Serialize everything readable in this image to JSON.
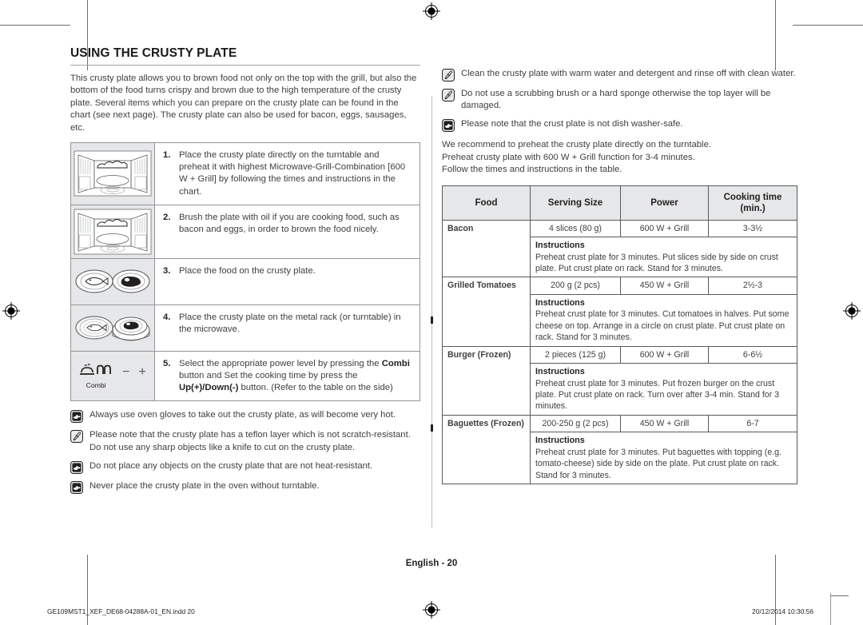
{
  "document": {
    "title": "USING THE CRUSTY PLATE",
    "intro": "This crusty plate allows you to brown food not only on the top with the grill, but also the bottom of the food turns crispy and brown due to the high temperature of the crusty plate. Several items which you can prepare on the crusty plate can be found in the chart (see next page). The crusty plate can also be used for bacon, eggs, sausages, etc.",
    "page_label": "English - 20",
    "footer_left": "GE109MST1_XEF_DE68-04288A-01_EN.indd   20",
    "footer_right": "20/12/2014   10:30:56"
  },
  "steps": [
    {
      "number": "1.",
      "figure": "microwave-open-door-illustration",
      "parts": [
        {
          "text": "Place the crusty plate directly on the turntable and preheat it with highest Microwave-Grill-Combination [600 W + Grill] by following the times and instructions in the chart.",
          "bold": false
        }
      ]
    },
    {
      "number": "2.",
      "figure": "microwave-open-door-illustration",
      "parts": [
        {
          "text": "Brush the plate with oil if you are cooking food, such as bacon and eggs, in order to brown the food nicely.",
          "bold": false
        }
      ]
    },
    {
      "number": "3.",
      "figure": "plates-fish-meat-illustration",
      "parts": [
        {
          "text": "Place the food on the crusty plate.",
          "bold": false
        }
      ]
    },
    {
      "number": "4.",
      "figure": "plates-on-rack-illustration",
      "parts": [
        {
          "text": "Place the crusty plate on the metal rack (or turntable) in the microwave.",
          "bold": false
        }
      ]
    },
    {
      "number": "5.",
      "figure": "combi-button-illustration",
      "parts": [
        {
          "text": "Select the appropriate power level by pressing the ",
          "bold": false
        },
        {
          "text": "Combi",
          "bold": true
        },
        {
          "text": " button and Set the cooking time by press the ",
          "bold": false
        },
        {
          "text": "Up(+)/",
          "bold": true
        },
        {
          "text": "Down(-)",
          "bold": true
        },
        {
          "text": " button. (Refer to the table on the side)",
          "bold": false
        }
      ]
    }
  ],
  "combi_button": {
    "label": "Combi",
    "minus": "−",
    "plus": "+"
  },
  "left_notes": [
    {
      "icon": "hand-pointer-icon",
      "icon_style": "dark",
      "text": "Always use oven gloves to take out the crusty plate, as will become very hot."
    },
    {
      "icon": "note-pencil-icon",
      "icon_style": "light",
      "text": "Please note that the crusty plate has a teflon layer which is not scratch-resistant. Do not use any sharp objects like a knife to cut on the crusty plate."
    },
    {
      "icon": "hand-pointer-icon",
      "icon_style": "dark",
      "text": "Do not place any objects on the crusty plate that are not heat-resistant."
    },
    {
      "icon": "hand-pointer-icon",
      "icon_style": "dark",
      "text": "Never place the crusty plate in the oven without turntable."
    }
  ],
  "right_notes": [
    {
      "icon": "note-pencil-icon",
      "icon_style": "light",
      "text": "Clean the crusty plate with warm water and detergent and rinse off with clean water."
    },
    {
      "icon": "note-pencil-icon",
      "icon_style": "light",
      "text": "Do not use a scrubbing brush or a hard sponge otherwise the top layer will be damaged."
    },
    {
      "icon": "hand-pointer-icon",
      "icon_style": "dark",
      "text": "Please note that the crust plate is not dish washer-safe."
    }
  ],
  "recommendation": [
    "We recommend to preheat the crusty plate directly on the turntable.",
    "Preheat crusty plate with 600 W + Grill function for 3-4 minutes.",
    "Follow the times and instructions in the table."
  ],
  "cooking_table": {
    "headers": [
      "Food",
      "Serving Size",
      "Power",
      "Cooking time (min.)"
    ],
    "header_cooking_time_line1": "Cooking time",
    "header_cooking_time_line2": "(min.)",
    "instructions_label": "Instructions",
    "rows": [
      {
        "food": "Bacon",
        "serving_size": "4 slices (80 g)",
        "power": "600 W + Grill",
        "cooking_time": "3-3½",
        "instructions": "Preheat crust plate for 3 minutes. Put slices side by side on crust plate. Put crust plate on rack. Stand for 3 minutes."
      },
      {
        "food": "Grilled Tomatoes",
        "serving_size": "200 g (2 pcs)",
        "power": "450 W + Grill",
        "cooking_time": "2½-3",
        "instructions": "Preheat crust plate for 3 minutes. Cut tomatoes in halves. Put some cheese on top. Arrange in a circle on crust plate. Put crust plate on rack. Stand for 3 minutes."
      },
      {
        "food": "Burger (Frozen)",
        "serving_size": "2 pieces (125 g)",
        "power": "600 W + Grill",
        "cooking_time": "6-6½",
        "instructions": "Preheat crust plate for 3 minutes. Put frozen burger on the crust plate. Put crust plate on rack. Turn over after 3-4 min. Stand for 3 minutes."
      },
      {
        "food": "Baguettes (Frozen)",
        "serving_size": "200-250 g (2 pcs)",
        "power": "450 W + Grill",
        "cooking_time": "6-7",
        "instructions": "Preheat crust plate for 3 minutes. Put baguettes with topping (e.g. tomato-cheese) side by side on the plate. Put crust plate on rack. Stand for 3 minutes."
      }
    ]
  },
  "colors": {
    "text": "#404040",
    "heading": "#231f20",
    "rule": "#a7a9ac",
    "table_border": "#58595b",
    "header_fill": "#e6e7e8",
    "figure_fill": "#e6e7e8",
    "crop_mark": "#6d6e71"
  }
}
